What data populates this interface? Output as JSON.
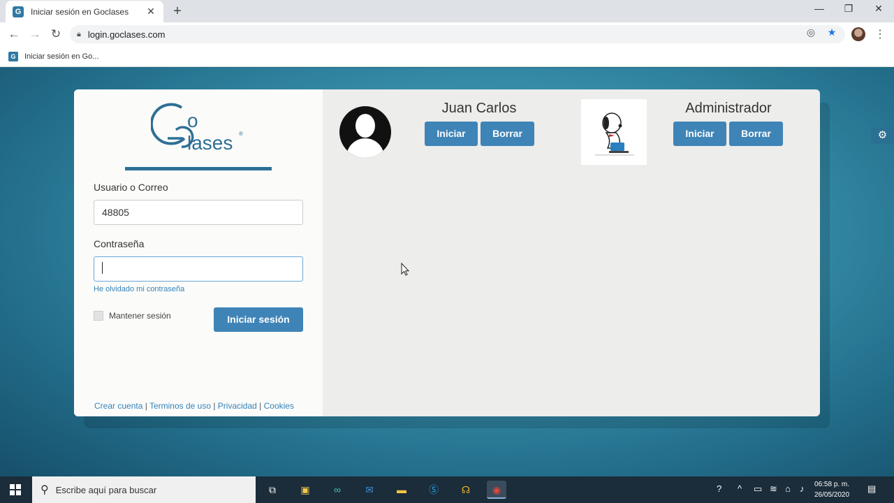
{
  "browser": {
    "tab_title": "Iniciar sesión en Goclases",
    "url": "login.goclases.com",
    "bookmark_label": "Iniciar sesión en Go..."
  },
  "login": {
    "logo_text_o": "o",
    "logo_text_lases": "lases",
    "username_label": "Usuario o Correo",
    "username_value": "48805",
    "password_label": "Contraseña",
    "password_value": "",
    "forgot_link": "He olvidado mi contraseña",
    "keep_session_label": "Mantener sesión",
    "login_button": "Iniciar sesión",
    "footer": {
      "create_account": "Crear cuenta",
      "terms": "Terminos de uso",
      "privacy": "Privacidad",
      "cookies": "Cookies",
      "separator": " | "
    }
  },
  "accounts": [
    {
      "name": "Juan Carlos",
      "start_label": "Iniciar",
      "delete_label": "Borrar",
      "avatar": "default-user-silhouette"
    },
    {
      "name": "Administrador",
      "start_label": "Iniciar",
      "delete_label": "Borrar",
      "avatar": "snoopy-image"
    }
  ],
  "taskbar": {
    "search_placeholder": "Escribe aquí para buscar",
    "time": "06:58 p. m.",
    "date": "26/05/2020"
  },
  "colors": {
    "accent": "#3f84b7",
    "link": "#3582b9",
    "logo_bar": "#2f6f96"
  }
}
